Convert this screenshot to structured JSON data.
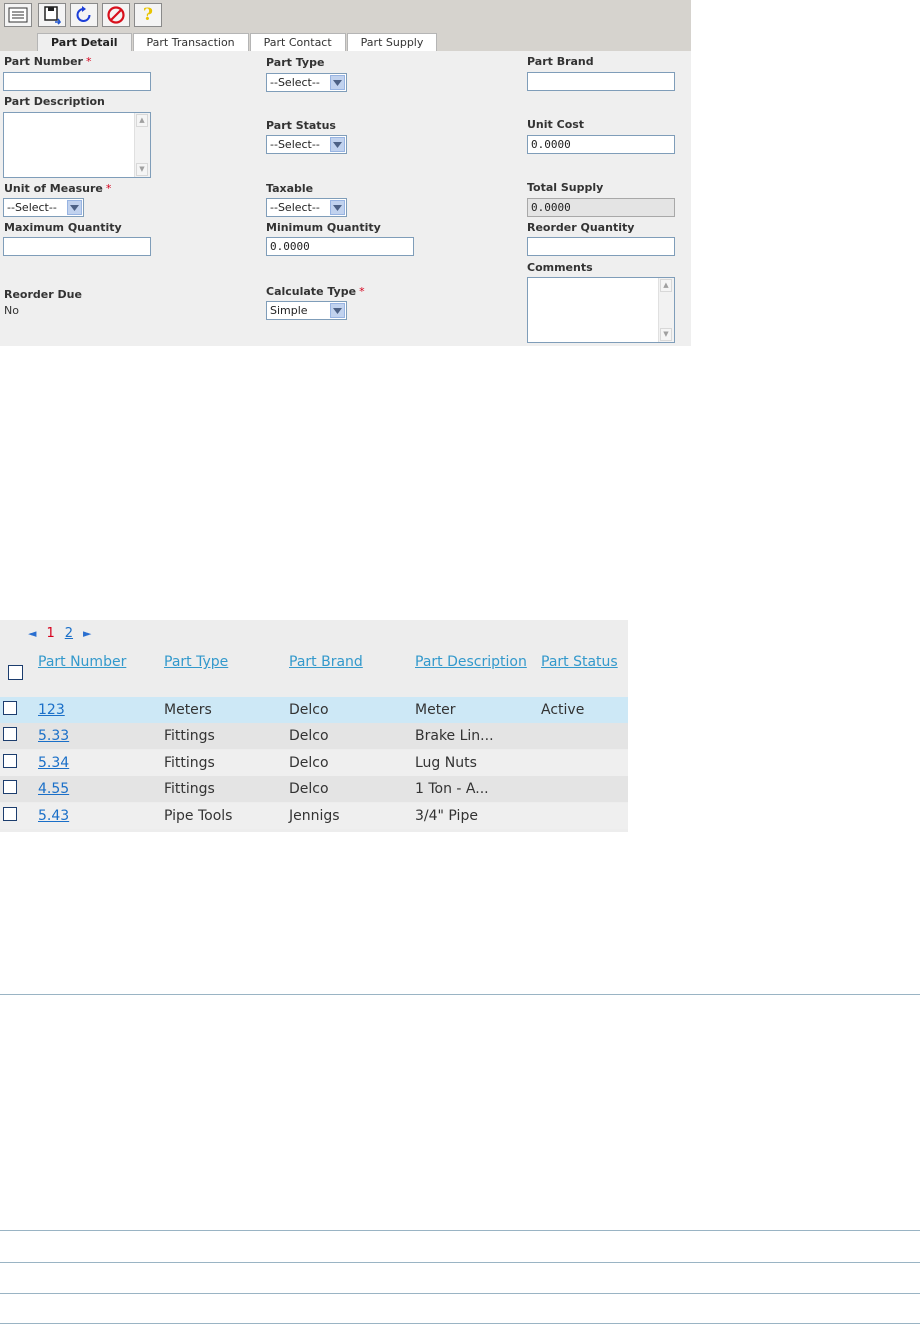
{
  "toolbar": {
    "buttons": [
      {
        "icon": "list-icon"
      },
      {
        "icon": "save-icon"
      },
      {
        "icon": "refresh-icon"
      },
      {
        "icon": "cancel-icon"
      },
      {
        "icon": "help-icon",
        "glyph": "?"
      }
    ]
  },
  "tabs": [
    "Part Detail",
    "Part Transaction",
    "Part Contact",
    "Part Supply"
  ],
  "active_tab": "Part Detail",
  "form": {
    "part_number": {
      "label": "Part Number",
      "required": "*",
      "value": ""
    },
    "part_type": {
      "label": "Part Type",
      "value": "--Select--"
    },
    "part_brand": {
      "label": "Part Brand",
      "value": ""
    },
    "part_description": {
      "label": "Part Description",
      "value": ""
    },
    "part_status": {
      "label": "Part Status",
      "value": "--Select--"
    },
    "unit_cost": {
      "label": "Unit Cost",
      "value": "0.0000"
    },
    "unit_of_measure": {
      "label": "Unit of Measure",
      "required": "*",
      "value": "--Select--"
    },
    "taxable": {
      "label": "Taxable",
      "value": "--Select--"
    },
    "total_supply": {
      "label": "Total Supply",
      "value": "0.0000"
    },
    "maximum_quantity": {
      "label": "Maximum Quantity",
      "value": ""
    },
    "minimum_quantity": {
      "label": "Minimum Quantity",
      "value": "0.0000"
    },
    "reorder_quantity": {
      "label": "Reorder Quantity",
      "value": ""
    },
    "comments": {
      "label": "Comments",
      "value": ""
    },
    "reorder_due": {
      "label": "Reorder Due",
      "value": "No"
    },
    "calculate_type": {
      "label": "Calculate Type",
      "required": "*",
      "value": "Simple"
    }
  },
  "pager": {
    "prev": "◄",
    "pages": [
      "1",
      "2"
    ],
    "current": "1",
    "next": "►"
  },
  "grid": {
    "columns": [
      "Part Number",
      "Part Type",
      "Part Brand",
      "Part Description",
      "Part Status"
    ],
    "rows": [
      {
        "number": "123",
        "type": "Meters",
        "brand": "Delco",
        "description": "Meter",
        "status": "Active",
        "selected": true
      },
      {
        "number": "5.33",
        "type": "Fittings",
        "brand": "Delco",
        "description": "Brake Lin...",
        "status": ""
      },
      {
        "number": "5.34",
        "type": "Fittings",
        "brand": "Delco",
        "description": "Lug Nuts",
        "status": ""
      },
      {
        "number": "4.55",
        "type": "Fittings",
        "brand": "Delco",
        "description": "1 Ton - A...",
        "status": ""
      },
      {
        "number": "5.43",
        "type": "Pipe Tools",
        "brand": "Jennigs",
        "description": "3/4\" Pipe",
        "status": ""
      }
    ]
  },
  "colors": {
    "accent_link": "#3399cc",
    "required": "#d6001c",
    "selected_row": "#cde8f6",
    "toolbar_bg": "#d6d3ce"
  }
}
